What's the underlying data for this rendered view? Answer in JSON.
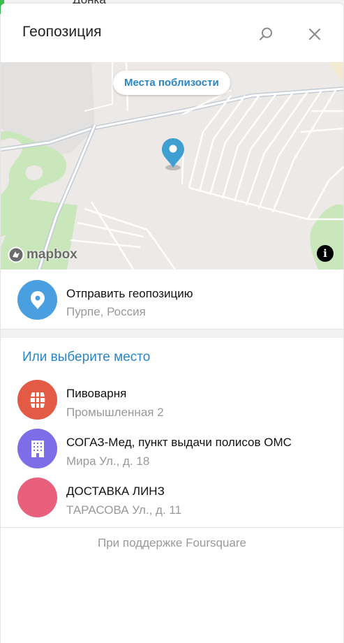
{
  "backdrop": {
    "partial_text": "Донка"
  },
  "header": {
    "title": "Геопозиция"
  },
  "map": {
    "nearby_button": "Места поблизости",
    "attribution_logo": "mapbox",
    "info_icon": "i",
    "pin_color": "#3f9fd0"
  },
  "send_location": {
    "title": "Отправить геопозицию",
    "subtitle": "Пурпе, Россия",
    "icon": "location-pin-icon",
    "color": "#4a9fe0"
  },
  "places_section": {
    "title": "Или выберите место"
  },
  "places": [
    {
      "name": "Пивоварня",
      "address": "Промышленная 2",
      "icon": "beer-barrel-icon",
      "color": "#e35a45"
    },
    {
      "name": "СОГАЗ-Мед, пункт выдачи полисов ОМС",
      "address": "Мира Ул., д. 18",
      "icon": "building-icon",
      "color": "#7d6de6"
    },
    {
      "name": "ДОСТАВКА ЛИНЗ",
      "address": "ТАРАСОВА Ул., д. 11",
      "icon": "blank-icon",
      "color": "#e8607c"
    }
  ],
  "footer": {
    "text": "При поддержке Foursquare"
  },
  "colors": {
    "accent": "#2a85c3",
    "secondary_text": "#999999"
  }
}
